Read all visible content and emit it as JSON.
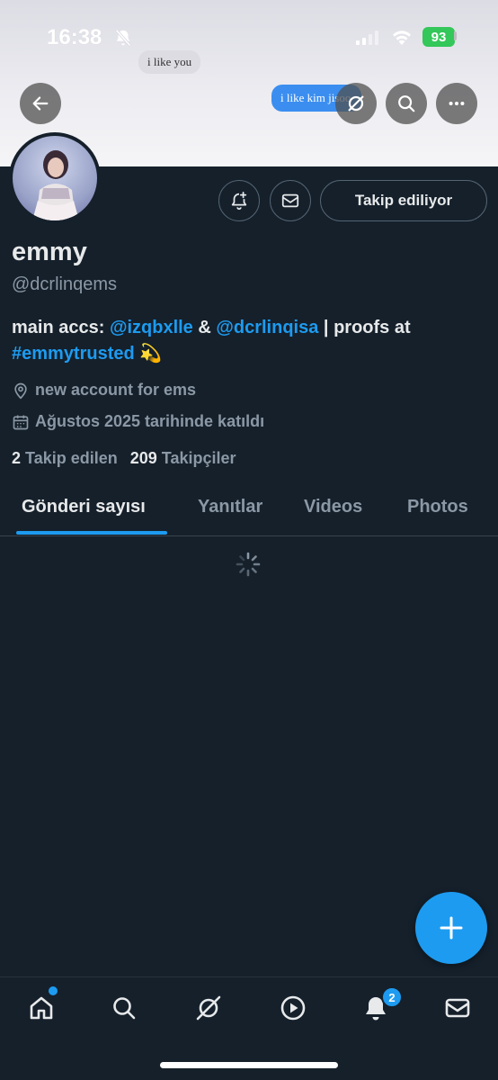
{
  "status_bar": {
    "time": "16:38",
    "battery": "93"
  },
  "banner": {
    "message_grey": "i like you",
    "message_blue": "i like kim jisoo"
  },
  "header_buttons": {
    "back": "back-arrow-icon",
    "grok": "grok-icon",
    "search": "search-icon",
    "more": "more-icon"
  },
  "profile": {
    "name": "emmy",
    "handle": "@dcrlinqems",
    "follow_button": "Takip ediliyor",
    "bio": {
      "prefix": "main accs: ",
      "mention1": "@izqbxlle",
      "and": " & ",
      "mention2": "@dcrlinqisa",
      "mid": " | proofs at ",
      "hashtag": "#emmytrusted",
      "emoji": "💫"
    },
    "location": "new account for ems",
    "joined": "Ağustos 2025 tarihinde katıldı",
    "following_count": "2",
    "following_label": "Takip edilen",
    "followers_count": "209",
    "followers_label": "Takipçiler"
  },
  "tabs": [
    "Gönderi sayısı",
    "Yanıtlar",
    "Videos",
    "Photos"
  ],
  "active_tab": "Gönderi sayısı",
  "nav": {
    "notification_badge": "2"
  },
  "colors": {
    "background": "#15202b",
    "accent": "#1d9bf0",
    "muted": "#8b98a5",
    "battery": "#34c759"
  }
}
